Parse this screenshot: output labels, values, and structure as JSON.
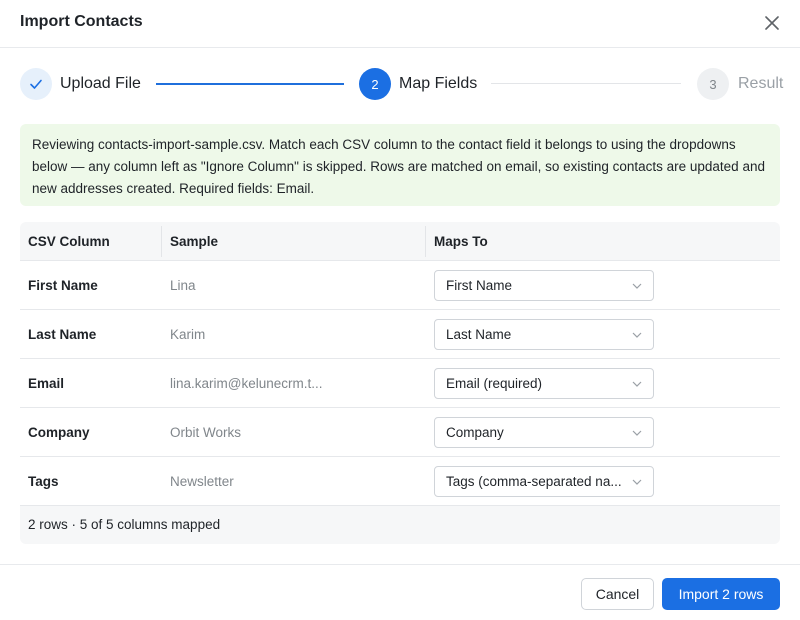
{
  "dialog": {
    "title": "Import Contacts",
    "close_icon": "close-icon"
  },
  "stepper": {
    "steps": [
      {
        "label": "Upload File",
        "indicator": "✓",
        "state": "done"
      },
      {
        "label": "Map Fields",
        "indicator": "2",
        "state": "active"
      },
      {
        "label": "Result",
        "indicator": "3",
        "state": "pending"
      }
    ]
  },
  "note": {
    "text": "Reviewing contacts-import-sample.csv. Match each CSV column to the contact field it belongs to using the dropdowns below — any column left as \"Ignore Column\" is skipped. Rows are matched on email, so existing contacts are updated and new addresses created. Required fields: Email."
  },
  "table": {
    "headers": [
      "CSV Column",
      "Sample",
      "Maps To"
    ],
    "rows": [
      {
        "column": "First Name",
        "sample": "Lina",
        "maps_to": "First Name"
      },
      {
        "column": "Last Name",
        "sample": "Karim",
        "maps_to": "Last Name"
      },
      {
        "column": "Email",
        "sample": "lina.karim@kelunecrm.t...",
        "maps_to": "Email (required)"
      },
      {
        "column": "Company",
        "sample": "Orbit Works",
        "maps_to": "Company"
      },
      {
        "column": "Tags",
        "sample": "Newsletter",
        "maps_to": "Tags (comma-separated na..."
      }
    ],
    "summary": "2 rows · 5 of 5 columns mapped"
  },
  "footer": {
    "cancel_label": "Cancel",
    "import_label": "Import 2 rows"
  },
  "colors": {
    "accent": "#1b6fe3",
    "note_bg": "#eef9e9",
    "muted_text": "#80868b"
  }
}
